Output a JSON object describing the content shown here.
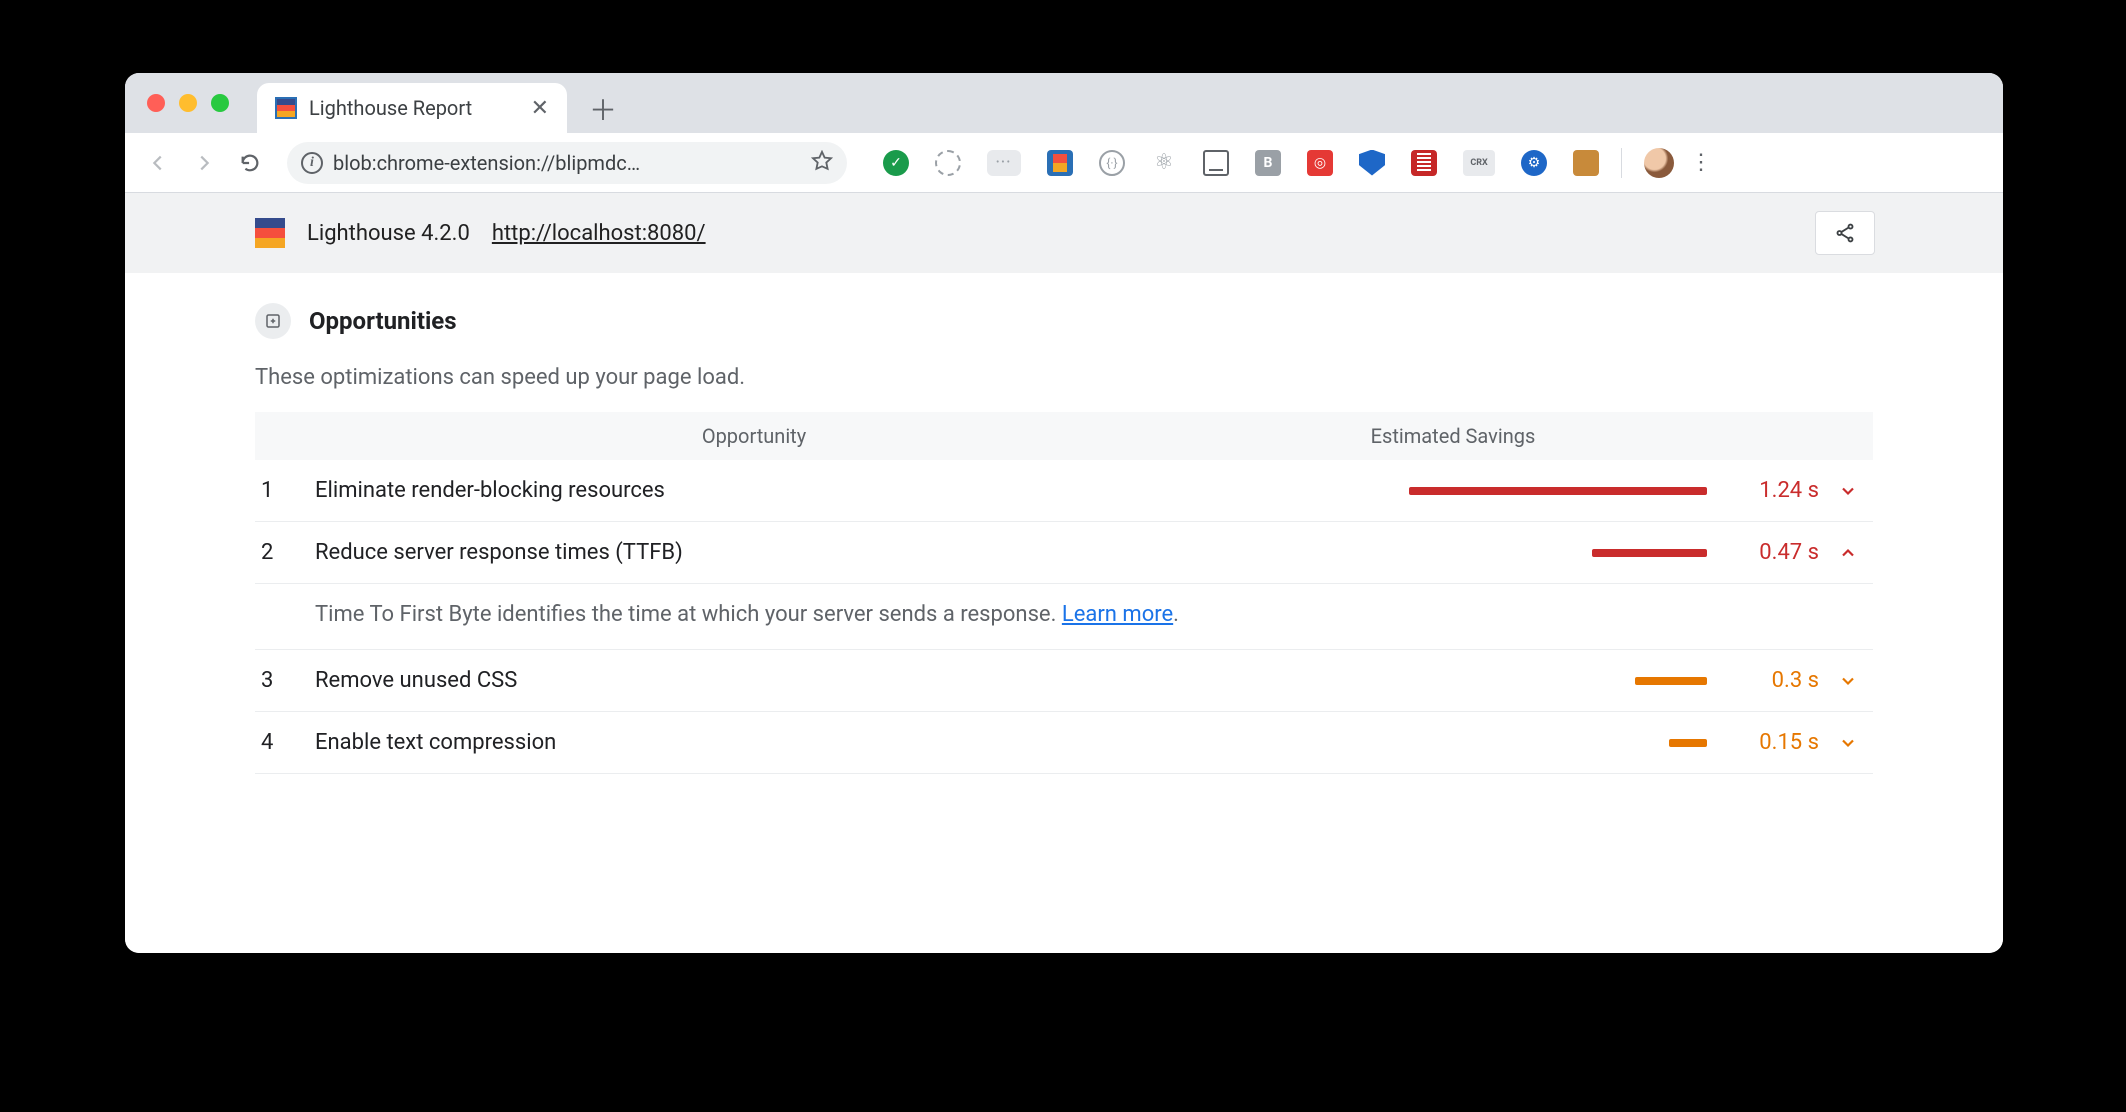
{
  "browser": {
    "tab_title": "Lighthouse Report",
    "url_display": "blob:chrome-extension://blipmdc…",
    "extensions": [
      "green-check",
      "globe",
      "pill",
      "lh",
      "braces",
      "atom",
      "device",
      "b",
      "spiral",
      "shield",
      "book",
      "crx",
      "gear",
      "chest"
    ]
  },
  "lighthouse": {
    "version_label": "Lighthouse 4.2.0",
    "tested_url": "http://localhost:8080/"
  },
  "section": {
    "title": "Opportunities",
    "description": "These optimizations can speed up your page load.",
    "col_opportunity": "Opportunity",
    "col_savings": "Estimated Savings"
  },
  "opportunities": [
    {
      "idx": "1",
      "name": "Eliminate render-blocking resources",
      "savings": "1.24 s",
      "severity": "red",
      "bar_pct": 62,
      "expanded": false
    },
    {
      "idx": "2",
      "name": "Reduce server response times (TTFB)",
      "savings": "0.47 s",
      "severity": "red",
      "bar_pct": 24,
      "expanded": true,
      "detail_text": "Time To First Byte identifies the time at which your server sends a response. ",
      "detail_link": "Learn more",
      "detail_suffix": "."
    },
    {
      "idx": "3",
      "name": "Remove unused CSS",
      "savings": "0.3 s",
      "severity": "orange",
      "bar_pct": 15,
      "expanded": false
    },
    {
      "idx": "4",
      "name": "Enable text compression",
      "savings": "0.15 s",
      "severity": "orange",
      "bar_pct": 8,
      "expanded": false
    }
  ],
  "colors": {
    "red": "#c92c2c",
    "orange": "#e67700",
    "link": "#1a73e8"
  }
}
